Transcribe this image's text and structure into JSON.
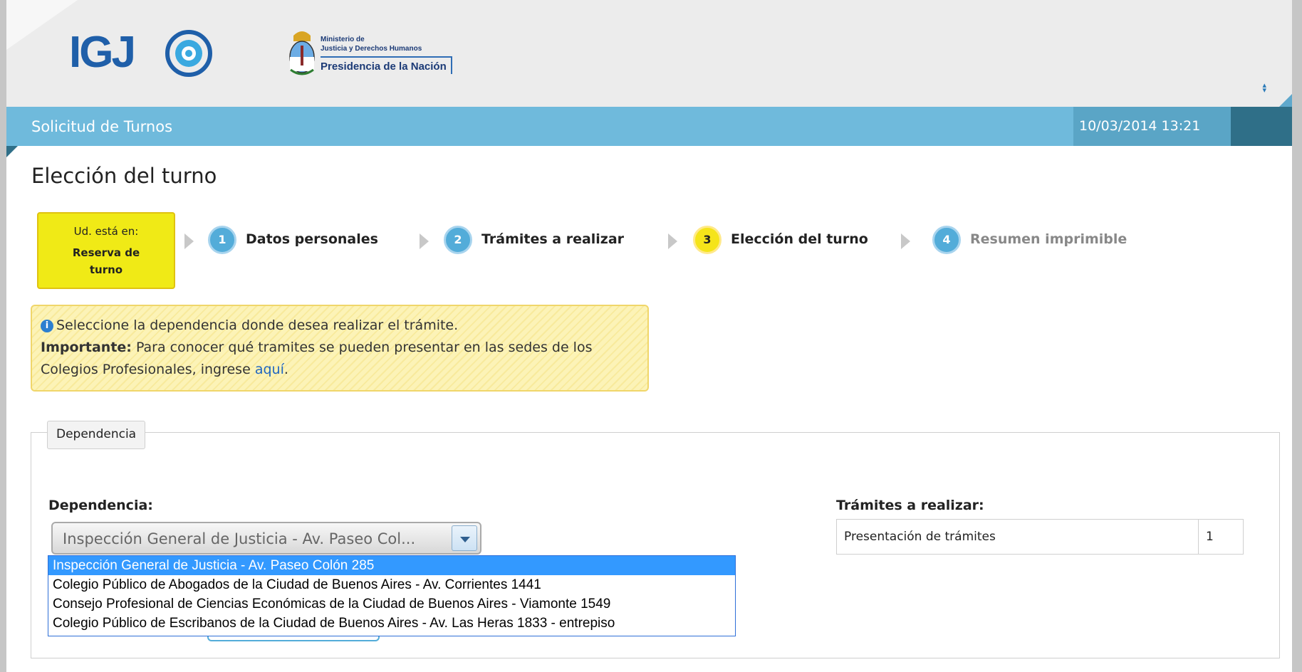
{
  "header": {
    "logo_text": "IGJ",
    "ministry_line1": "Ministerio de",
    "ministry_line2": "Justicia y Derechos Humanos",
    "ministry_line3": "Presidencia de la Nación"
  },
  "titlebar": {
    "title": "Solicitud de Turnos",
    "datetime": "10/03/2014 13:21"
  },
  "page_title": "Elección del turno",
  "steps": {
    "current_prefix": "Ud. está en:",
    "current_label": "Reserva de turno",
    "items": [
      {
        "number": "1",
        "label": "Datos personales"
      },
      {
        "number": "2",
        "label": "Trámites a realizar"
      },
      {
        "number": "3",
        "label": "Elección del turno"
      },
      {
        "number": "4",
        "label": "Resumen imprimible"
      }
    ]
  },
  "info": {
    "line1": "Seleccione la dependencia donde desea realizar el trámite.",
    "important_label": "Importante:",
    "line2": "Para conocer qué tramites se pueden presentar en las sedes de los Colegios Profesionales, ingrese",
    "link_text": "aquí",
    "period": "."
  },
  "fieldset": {
    "legend": "Dependencia",
    "dependencia_label": "Dependencia:",
    "select_value": "Inspección General de Justicia - Av. Paseo Col...",
    "options": [
      "Inspección General de Justicia - Av. Paseo Colón 285",
      "Colegio Público de Abogados de la Ciudad de Buenos Aires - Av. Corrientes 1441",
      "Consejo Profesional de Ciencias Económicas de la Ciudad de Buenos Aires - Viamonte 1549",
      "Colegio Público de Escribanos de la Ciudad de Buenos Aires - Av. Las Heras 1833 - entrepiso"
    ],
    "tramites_label": "Trámites a realizar:",
    "tramites": [
      {
        "name": "Presentación de trámites",
        "qty": "1"
      }
    ]
  },
  "colors": {
    "titlebar": "#6fbadc",
    "step_circle": "#53acd9",
    "step_active": "#f5e41a",
    "current_box": "#f0ea16",
    "dropdown_selected": "#3399ff"
  }
}
